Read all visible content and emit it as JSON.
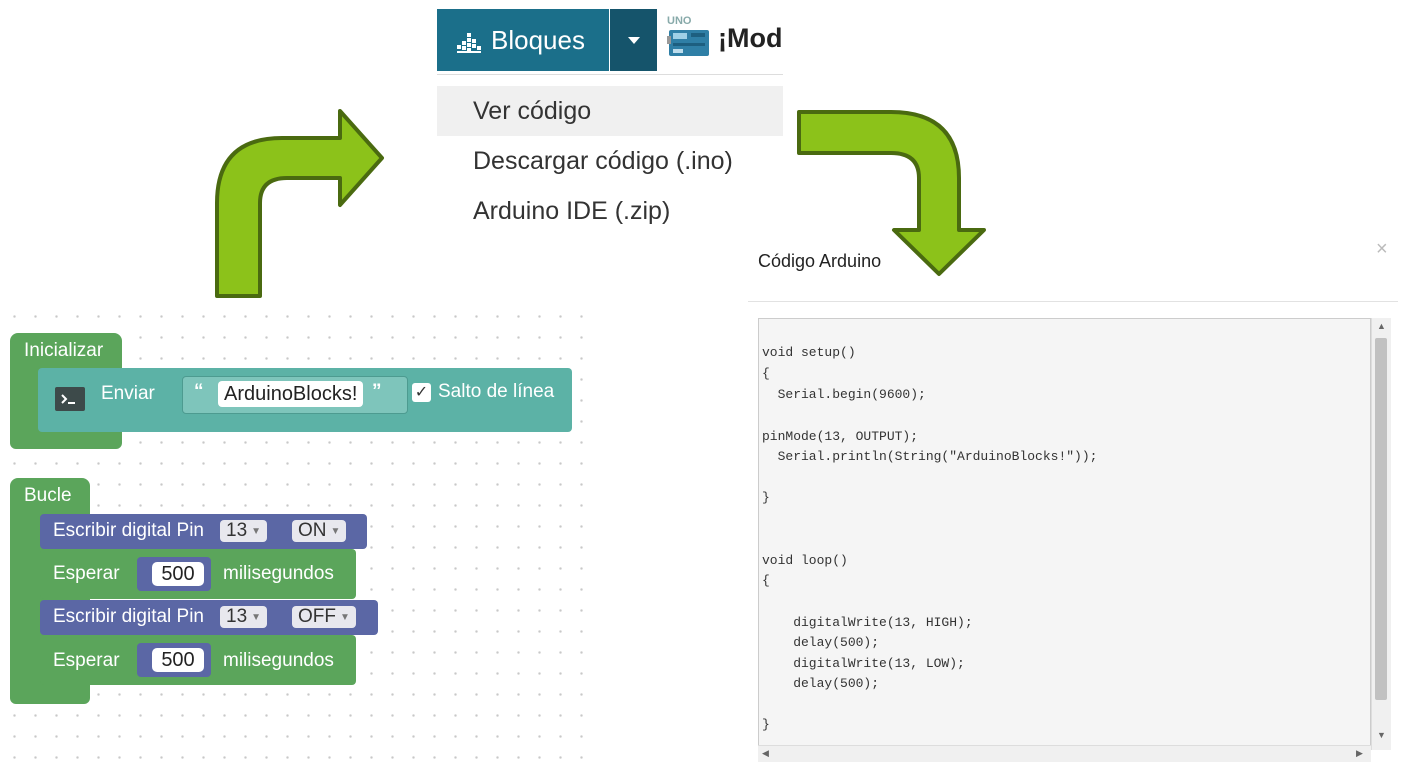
{
  "toolbar": {
    "blocks_button_label": "Bloques",
    "board_label": "UNO",
    "mode_text": "¡Mod"
  },
  "menu": {
    "items": [
      {
        "label": "Ver código"
      },
      {
        "label": "Descargar código (.ino)"
      },
      {
        "label": "Arduino IDE (.zip)"
      }
    ]
  },
  "workspace": {
    "init_block": {
      "label": "Inicializar",
      "send_label": "Enviar",
      "string_value": "ArduinoBlocks!",
      "open_quote": "“",
      "close_quote": "”",
      "newline_label": "Salto de línea",
      "check": "✓"
    },
    "loop_block": {
      "label": "Bucle",
      "statements": [
        {
          "type": "digital_write",
          "label": "Escribir digital Pin",
          "pin": "13",
          "state": "ON"
        },
        {
          "type": "delay",
          "label": "Esperar",
          "value": "500",
          "unit": "milisegundos"
        },
        {
          "type": "digital_write",
          "label": "Escribir digital Pin",
          "pin": "13",
          "state": "OFF"
        },
        {
          "type": "delay",
          "label": "Esperar",
          "value": "500",
          "unit": "milisegundos"
        }
      ]
    }
  },
  "dialog": {
    "title": "Código Arduino",
    "close_symbol": "×",
    "code_lines": [
      "void setup()",
      "{",
      "  Serial.begin(9600);",
      "",
      "pinMode(13, OUTPUT);",
      "  Serial.println(String(\"ArduinoBlocks!\"));",
      "",
      "}",
      "",
      "",
      "void loop()",
      "{",
      "",
      "    digitalWrite(13, HIGH);",
      "    delay(500);",
      "    digitalWrite(13, LOW);",
      "    delay(500);",
      "",
      "}"
    ]
  },
  "colors": {
    "toolbar_blue": "#1b6f8a",
    "toolbar_dark": "#15546b",
    "arrow_green": "#8cc21a",
    "arrow_outline": "#4a6a10",
    "block_green": "#5ba55b",
    "block_teal": "#5cb2a6",
    "block_purple": "#5b67a5"
  },
  "icons": {
    "blocks_icon": "bar-chart-icon",
    "board_icon": "arduino-board-icon",
    "terminal_icon": "terminal-icon"
  }
}
